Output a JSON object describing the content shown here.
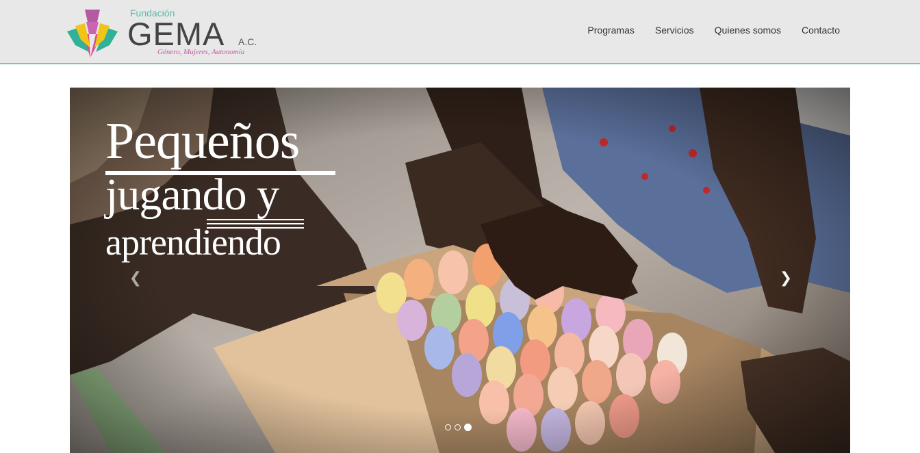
{
  "brand": {
    "fundacion": "Fundación",
    "name": "GEMA",
    "suffix": "A.C.",
    "tagline": "Género, Mujeres, Autonomía"
  },
  "nav": [
    {
      "label": "Programas"
    },
    {
      "label": "Servicios"
    },
    {
      "label": "Quienes somos"
    },
    {
      "label": "Contacto"
    }
  ],
  "carousel": {
    "caption_line1": "Pequeños",
    "caption_line2": "jugando   y",
    "caption_line3": "aprendiendo",
    "prev_icon": "chevron-left-icon",
    "next_icon": "chevron-right-icon",
    "slides_count": 3,
    "active_slide": 3
  },
  "colors": {
    "header_bg": "#e8e8e8",
    "accent": "#7dc4b5",
    "tagline": "#c25aa3"
  }
}
